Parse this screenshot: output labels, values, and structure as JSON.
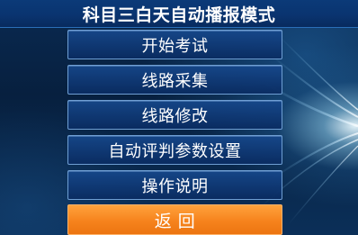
{
  "header": {
    "title": "科目三白天自动播报模式"
  },
  "menu": {
    "items": [
      {
        "label": "开始考试"
      },
      {
        "label": "线路采集"
      },
      {
        "label": "线路修改"
      },
      {
        "label": "自动评判参数设置"
      },
      {
        "label": "操作说明"
      }
    ],
    "back_label": "返 回"
  },
  "colors": {
    "title_bar": "#0a3470",
    "button_fill": "#12407f",
    "button_border": "#6f9fd4",
    "back_button": "#f6831d",
    "background": "#07203f"
  }
}
